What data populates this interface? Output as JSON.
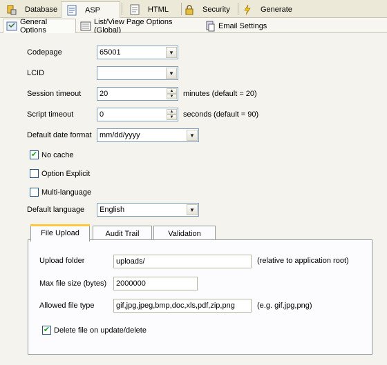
{
  "top_tabs": [
    {
      "label": "Database",
      "icon": "database-icon"
    },
    {
      "label": "ASP",
      "icon": "asp-page-icon"
    },
    {
      "label": "HTML",
      "icon": "html-page-icon"
    },
    {
      "label": "Security",
      "icon": "lock-icon"
    },
    {
      "label": "Generate",
      "icon": "lightning-icon"
    }
  ],
  "sub_tabs": [
    {
      "label": "General Options",
      "icon": "general-options-icon"
    },
    {
      "label": "List/View Page Options (Global)",
      "icon": "list-view-icon"
    },
    {
      "label": "Email Settings",
      "icon": "email-settings-icon"
    }
  ],
  "form": {
    "codepage": {
      "label": "Codepage",
      "value": "65001"
    },
    "lcid": {
      "label": "LCID",
      "value": ""
    },
    "session_timeout": {
      "label": "Session timeout",
      "value": "20",
      "hint": "minutes (default = 20)"
    },
    "script_timeout": {
      "label": "Script timeout",
      "value": "0",
      "hint": "seconds (default = 90)"
    },
    "date_format": {
      "label": "Default date format",
      "value": "mm/dd/yyyy"
    },
    "no_cache": {
      "label": "No cache",
      "checked": true
    },
    "option_explicit": {
      "label": "Option Explicit",
      "checked": false
    },
    "multi_language": {
      "label": "Multi-language",
      "checked": false
    },
    "default_language": {
      "label": "Default language",
      "value": "English"
    }
  },
  "inner_tabs": [
    "File Upload",
    "Audit Trail",
    "Validation"
  ],
  "file_upload": {
    "upload_folder": {
      "label": "Upload folder",
      "value": "uploads/",
      "hint": "(relative to application root)"
    },
    "max_file_size": {
      "label": "Max file size (bytes)",
      "value": "2000000"
    },
    "allowed_types": {
      "label": "Allowed file type",
      "value": "gif,jpg,jpeg,bmp,doc,xls,pdf,zip,png",
      "hint": "(e.g. gif,jpg,png)"
    },
    "delete_on_update": {
      "label": "Delete file on update/delete",
      "checked": true
    }
  }
}
